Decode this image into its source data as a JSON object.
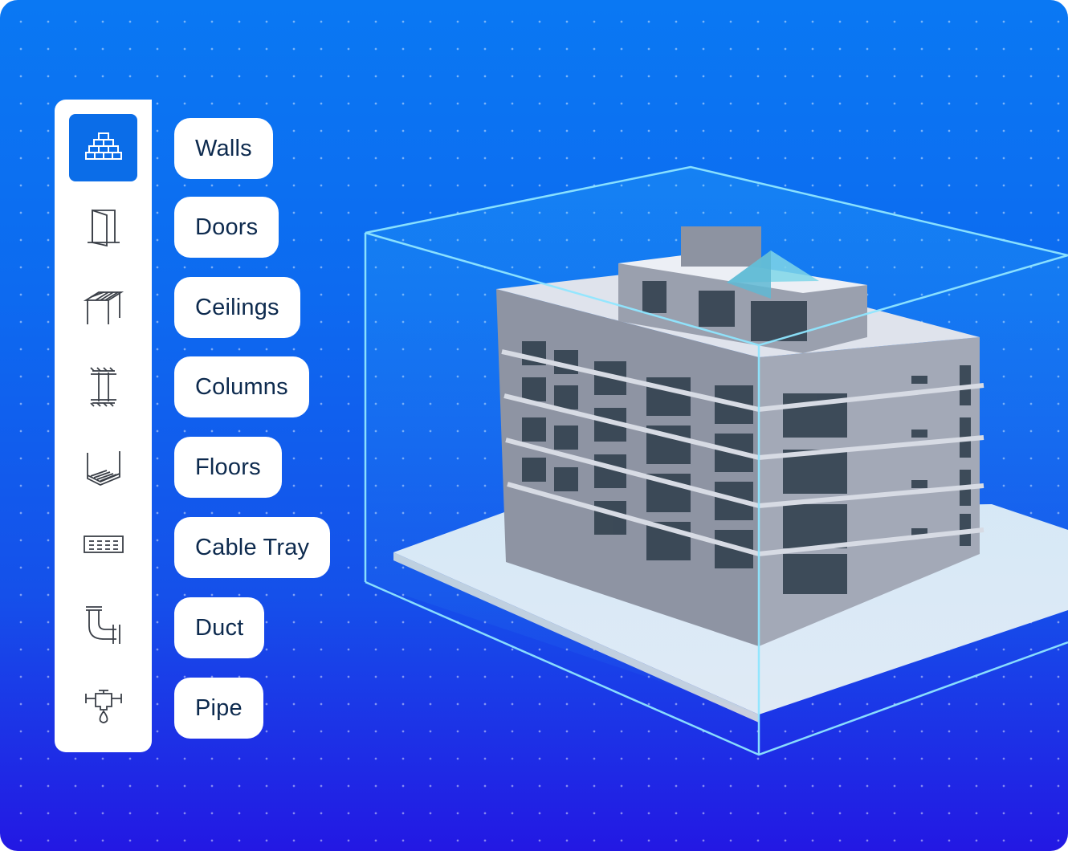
{
  "categories": [
    {
      "label": "Walls",
      "icon": "brick-wall-icon",
      "active": true
    },
    {
      "label": "Doors",
      "icon": "door-icon",
      "active": false
    },
    {
      "label": "Ceilings",
      "icon": "ceiling-icon",
      "active": false
    },
    {
      "label": "Columns",
      "icon": "column-icon",
      "active": false
    },
    {
      "label": "Floors",
      "icon": "floor-icon",
      "active": false
    },
    {
      "label": "Cable Tray",
      "icon": "cable-tray-icon",
      "active": false
    },
    {
      "label": "Duct",
      "icon": "duct-icon",
      "active": false
    },
    {
      "label": "Pipe",
      "icon": "pipe-icon",
      "active": false
    }
  ],
  "colors": {
    "accent": "#0b6de8",
    "chip_text": "#0d2a4e",
    "background_top": "#0a78f3",
    "background_bottom": "#2318e3"
  }
}
